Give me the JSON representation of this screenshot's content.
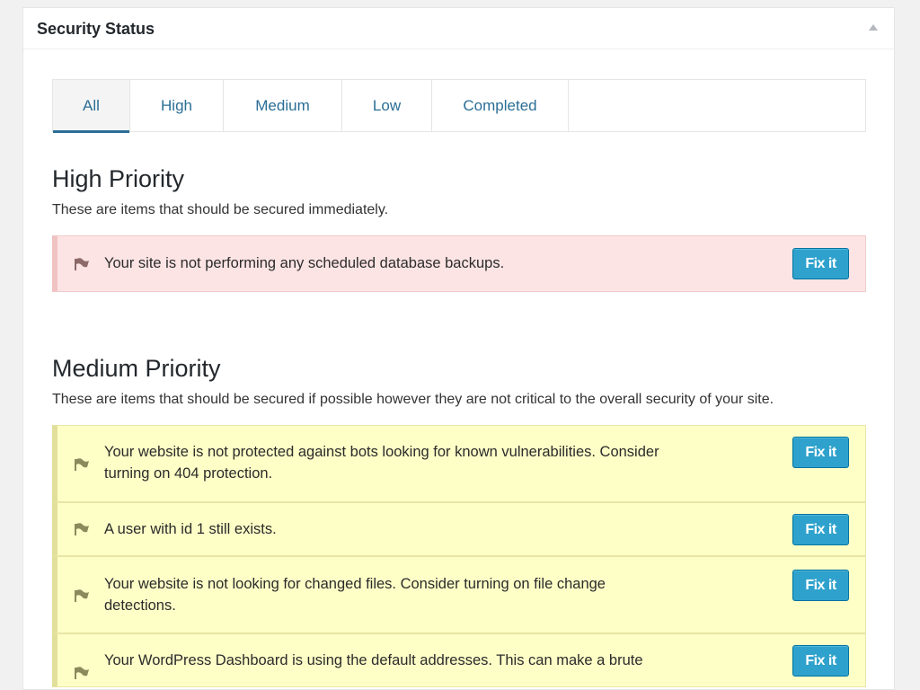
{
  "panel": {
    "title": "Security Status",
    "toggle_icon": "triangle-up-icon"
  },
  "tabs": [
    {
      "label": "All",
      "active": true
    },
    {
      "label": "High",
      "active": false
    },
    {
      "label": "Medium",
      "active": false
    },
    {
      "label": "Low",
      "active": false
    },
    {
      "label": "Completed",
      "active": false
    }
  ],
  "high": {
    "title": "High Priority",
    "description": "These are items that should be secured immediately.",
    "items": [
      {
        "text": "Your site is not performing any scheduled database backups.",
        "button": "Fix it",
        "icon": "flag-icon"
      }
    ]
  },
  "medium": {
    "title": "Medium Priority",
    "description": "These are items that should be secured if possible however they are not critical to the overall security of your site.",
    "items": [
      {
        "text": "Your website is not protected against bots looking for known vulnerabilities. Consider turning on 404 protection.",
        "button": "Fix it",
        "icon": "flag-icon"
      },
      {
        "text": "A user with id 1 still exists.",
        "button": "Fix it",
        "icon": "flag-icon"
      },
      {
        "text": "Your website is not looking for changed files. Consider turning on file change detections.",
        "button": "Fix it",
        "icon": "flag-icon"
      },
      {
        "text": "Your WordPress Dashboard is using the default addresses. This can make a brute",
        "button": "Fix it",
        "icon": "flag-icon"
      }
    ]
  },
  "colors": {
    "accent": "#2ea2cc",
    "tab_text": "#2a6e96",
    "high_bg": "#fde4e4",
    "medium_bg": "#fefec7"
  }
}
